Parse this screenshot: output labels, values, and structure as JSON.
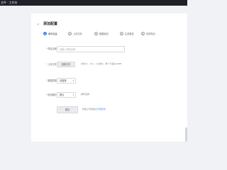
{
  "window": {
    "title": "文件 · 工作台"
  },
  "header": {
    "back_icon": "chevron-left-icon",
    "title": "添加配置"
  },
  "steps": [
    {
      "num": "1",
      "label": "填写信息",
      "active": true
    },
    {
      "num": "2",
      "label": "上传文件",
      "active": false
    },
    {
      "num": "3",
      "label": "数据检测",
      "active": false
    },
    {
      "num": "4",
      "label": "生成报告",
      "active": false
    },
    {
      "num": "5",
      "label": "完成导出",
      "active": false
    }
  ],
  "form": {
    "name_label": "* 项目名称",
    "name_placeholder": "请输入项目名称",
    "file_label": "* 上传文件",
    "file_button": "选择文件",
    "file_hint": "支持xls、xlsx、csv格式，单个不超过10MB",
    "type_label": "* 数据类型",
    "type_value": "请选择",
    "mode_label": "* 检测模式",
    "mode_value": "默认",
    "mode_hint": "推荐选择",
    "submit_label": "提交",
    "footer_hint": "查看上传模板及",
    "footer_link": "示例文件"
  }
}
